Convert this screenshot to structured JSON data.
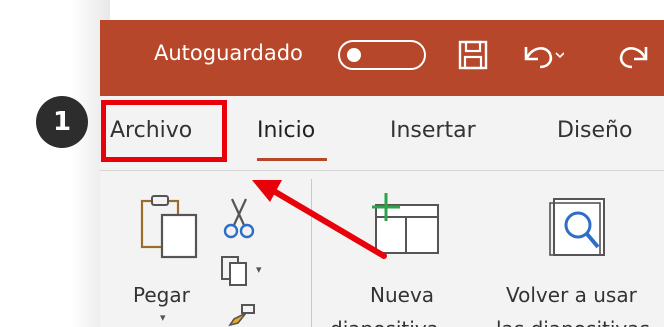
{
  "titlebar": {
    "autosave_label": "Autoguardado",
    "autosave_state": "off",
    "quick_access_icons": [
      "save-icon",
      "undo-icon",
      "redo-icon"
    ]
  },
  "tabs": [
    {
      "label": "Archivo"
    },
    {
      "label": "Inicio",
      "active": true
    },
    {
      "label": "Insertar"
    },
    {
      "label": "Diseño"
    }
  ],
  "ribbon": {
    "paste_label": "Pegar",
    "new_slide_label_1": "Nueva",
    "new_slide_label_2": "diapositiva",
    "reuse_label_1": "Volver a usar",
    "reuse_label_2": "las diapositivas"
  },
  "annotation": {
    "step_number": "1",
    "highlight_color": "#e8000b",
    "arrow_color": "#e8000b"
  },
  "colors": {
    "titlebar": "#b7472a",
    "accent": "#b7472a",
    "ribbon_bg": "#f3f3f3"
  }
}
